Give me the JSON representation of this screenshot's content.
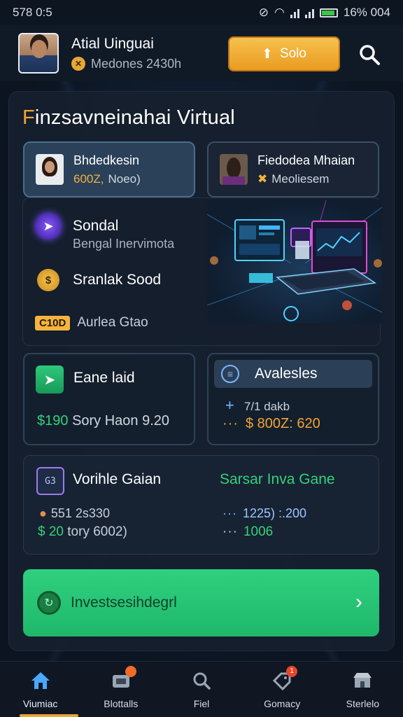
{
  "status_bar": {
    "time": "578 0:5",
    "battery_text": "16% 004"
  },
  "header": {
    "user_name": "Atial Uinguai",
    "user_sub": "Medones 2430h",
    "sale_label": "Solo",
    "icons": {
      "search": "search-icon",
      "coin": "coin-icon",
      "upload": "upload-arrow-icon"
    }
  },
  "main": {
    "title_first": "F",
    "title_rest": "inzsavneinahai Virtual",
    "profiles": [
      {
        "name": "Bhdedkesin",
        "value": "600Z,",
        "sub": "Noeo)"
      },
      {
        "name": "Fiedodea Mhaian",
        "sub": "Meoliesem"
      }
    ],
    "list": [
      {
        "title": "Sondal",
        "sub": "Bengal Inervimota"
      },
      {
        "title": "Sranlak Sood"
      },
      {
        "badge": "C10D",
        "title": "Aurlea Gtao"
      }
    ],
    "stat_left": {
      "title": "Eane laid",
      "value_green": "$190",
      "value_rest": "Sory Haon 9.20"
    },
    "stat_right": {
      "title": "Avalesles",
      "row1": "7/1 dakb",
      "row2": "$ 800Z: 620"
    },
    "wide_card": {
      "icon_text": "G3",
      "title": "Vorihle Gaian",
      "green_title": "Sarsar Inva Gane",
      "left_row1": "551 2s330",
      "left_row2_green": "$ 20",
      "left_row2_rest": "tory 6002)",
      "right_row1": "1225) :.200",
      "right_row2": "1006"
    },
    "invest_label": "Investsesihdegrl"
  },
  "bottom_nav": [
    {
      "label": "Viumiac",
      "icon": "home-icon",
      "active": true
    },
    {
      "label": "Blottalls",
      "icon": "wallet-icon"
    },
    {
      "label": "Fiel",
      "icon": "search-icon"
    },
    {
      "label": "Gomacy",
      "icon": "tag-icon",
      "badge": "1"
    },
    {
      "label": "Sterlelo",
      "icon": "store-icon"
    }
  ],
  "colors": {
    "accent_orange": "#f2a436",
    "accent_green": "#33d27a",
    "background": "#0b1420"
  }
}
